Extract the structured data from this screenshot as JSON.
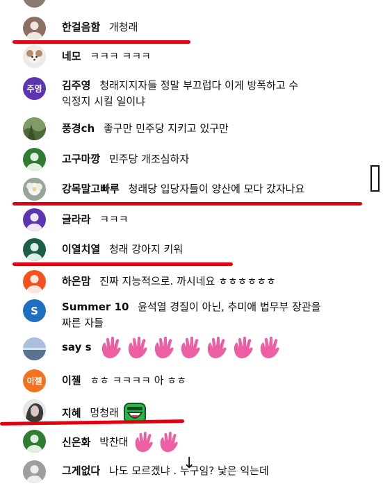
{
  "colors": {
    "underline": "#e00012",
    "avatar_default_bg": "#2a7a3a",
    "avatar_purple": "#5e35b1"
  },
  "comments": [
    {
      "author": "한걸음함",
      "message": "개청래",
      "avatar": "default-person-icon"
    },
    {
      "author": "네모",
      "message": "ㅋㅋㅋ ㅋㅋㅋ",
      "avatar": "dog-photo-avatar"
    },
    {
      "author": "김주영",
      "message": "청래지지자들 정말 부끄럽다 이게 방폭하고 수",
      "message2": "익정지 시킬 일이냐",
      "avatar_text": "주영"
    },
    {
      "author": "풍경ch",
      "message": "좋구만 민주당 지키고 있구만",
      "avatar": "landscape-photo-avatar"
    },
    {
      "author": "고구마깡",
      "message": "민주당 개조심하자",
      "avatar": "default-person-icon"
    },
    {
      "author": "강목말고빠루",
      "message": "청래당 입당자들이 양산에 모다 갔자나요",
      "avatar": "flower-photo-avatar"
    },
    {
      "author": "글라라",
      "message": "ㅋㅋㅋ",
      "avatar": "default-person-icon"
    },
    {
      "author": "이열치열",
      "message": "청래 강아지 키워",
      "avatar": "default-person-icon"
    },
    {
      "author": "하은맘",
      "message": "진짜 지능적으로. 까시네요 ㅎㅎㅎㅎㅎㅎ",
      "avatar": "default-person-icon"
    },
    {
      "author": "Summer 10",
      "message": "윤석열 경질이 아닌, 추미애 법무부 장관을",
      "message2": "짜른 자들",
      "avatar_text": "S"
    },
    {
      "author": "say s",
      "message": "",
      "avatar": "sky-photo-avatar"
    },
    {
      "author": "이젤",
      "message": "ㅎㅎ ㅋㅋㅋㅋ 아 ㅎㅎ",
      "avatar_text": "이젤"
    },
    {
      "author": "지혜",
      "message": "멍청래",
      "avatar": "portrait-photo-avatar"
    },
    {
      "author": "신은화",
      "message": "박찬대",
      "avatar": "default-person-icon"
    },
    {
      "author": "그게없다",
      "message": "나도 모르겠냐 . 누구임? 낯은 익는데",
      "avatar": "default-person-icon"
    }
  ]
}
